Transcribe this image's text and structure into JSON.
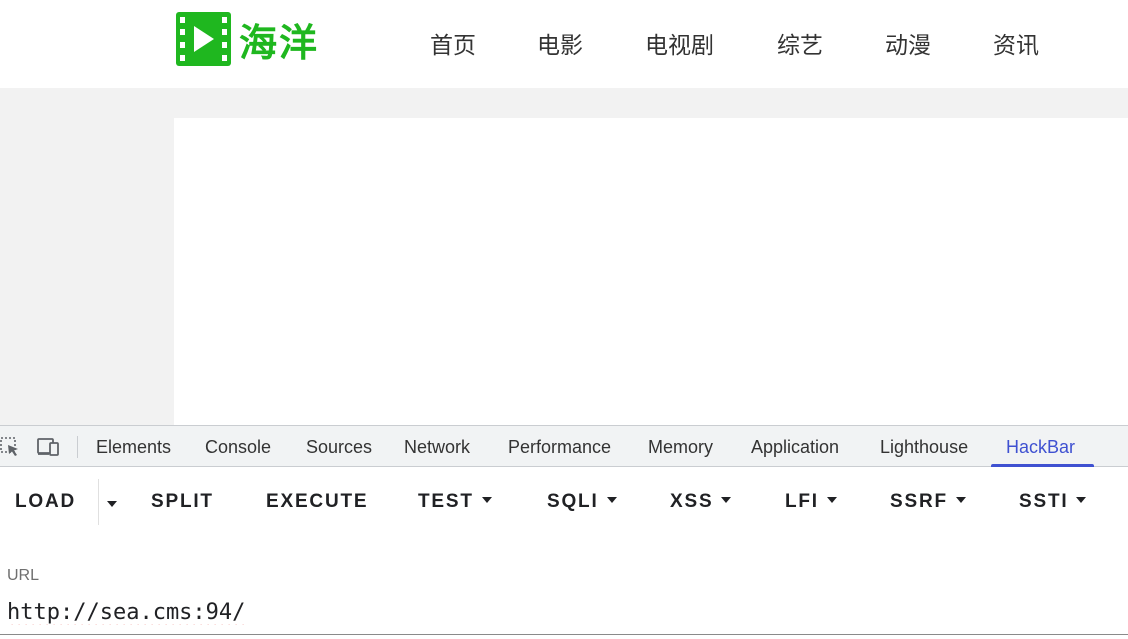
{
  "site": {
    "logo_text": "海洋",
    "logo_color": "#1fb71f",
    "nav": [
      {
        "label": "首页"
      },
      {
        "label": "电影"
      },
      {
        "label": "电视剧"
      },
      {
        "label": "综艺"
      },
      {
        "label": "动漫"
      },
      {
        "label": "资讯"
      }
    ]
  },
  "devtools": {
    "icons": [
      "inspect-element-icon",
      "device-toolbar-icon"
    ],
    "tabs": [
      {
        "label": "Elements"
      },
      {
        "label": "Console"
      },
      {
        "label": "Sources"
      },
      {
        "label": "Network"
      },
      {
        "label": "Performance"
      },
      {
        "label": "Memory"
      },
      {
        "label": "Application"
      },
      {
        "label": "Lighthouse"
      },
      {
        "label": "HackBar",
        "active": true
      }
    ],
    "accent_color": "#3f51d1"
  },
  "hackbar": {
    "buttons": [
      {
        "label": "LOAD"
      },
      {
        "label": "SPLIT"
      },
      {
        "label": "EXECUTE"
      },
      {
        "label": "TEST"
      },
      {
        "label": "SQLI"
      },
      {
        "label": "XSS"
      },
      {
        "label": "LFI"
      },
      {
        "label": "SSRF"
      },
      {
        "label": "SSTI"
      }
    ],
    "url_label": "URL",
    "url_value": "http://sea.cms:94/"
  }
}
